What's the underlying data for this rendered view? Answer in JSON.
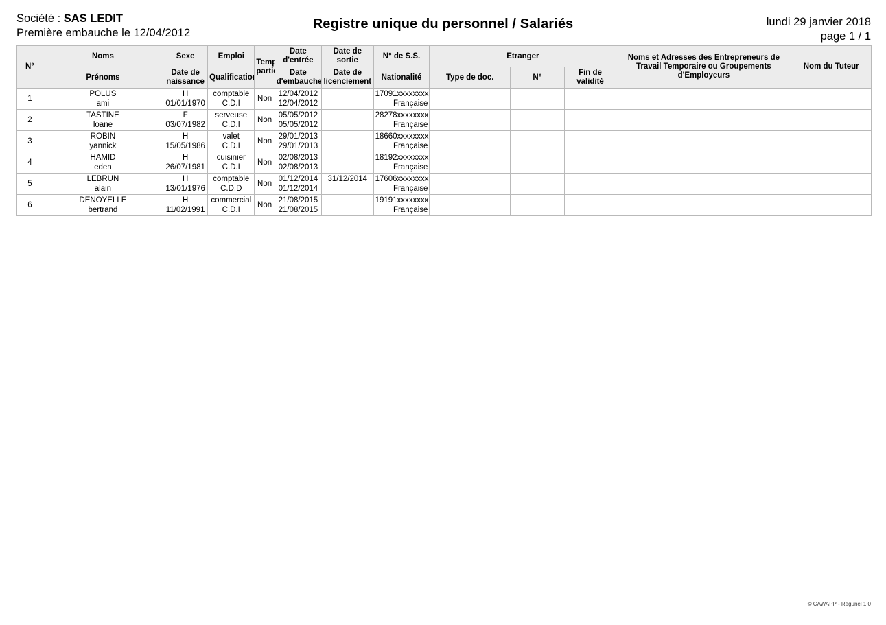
{
  "header": {
    "company_label": "Société : ",
    "company_name": "SAS LEDIT",
    "first_hire_line": "Première embauche le 12/04/2012",
    "title": "Registre unique du personnel / Salariés",
    "date": "lundi 29 janvier 2018",
    "page": "page 1 / 1"
  },
  "table": {
    "headers": {
      "num": "N°",
      "noms": "Noms",
      "prenoms": "Prénoms",
      "sexe": "Sexe",
      "date_naissance": "Date de naissance",
      "emploi": "Emploi",
      "qualification": "Qualification",
      "temps_partiel": "Temps partiel",
      "date_entree": "Date d'entrée",
      "date_embauche": "Date d'embauche",
      "date_sortie": "Date de sortie",
      "date_licenciement": "Date de licenciement",
      "num_ss": "N° de S.S.",
      "nationalite": "Nationalité",
      "etranger": "Etranger",
      "type_doc": "Type de doc.",
      "etranger_num": "N°",
      "fin_validite": "Fin de validité",
      "entrepreneurs": "Noms et Adresses des Entrepreneurs de Travail Temporaire ou Groupements d'Employeurs",
      "tuteur": "Nom du Tuteur"
    },
    "rows": [
      {
        "num": "1",
        "nom": "POLUS",
        "prenom": "ami",
        "sexe": "H",
        "date_naissance": "01/01/1970",
        "emploi": "comptable",
        "qualification": "C.D.I",
        "temps_partiel": "Non",
        "date_entree": "12/04/2012",
        "date_embauche": "12/04/2012",
        "date_sortie": "",
        "date_licenciement": "",
        "num_ss": "17091xxxxxxxx",
        "nationalite": "Française",
        "type_doc": "",
        "etranger_num": "",
        "fin_validite": "",
        "entrepreneurs": "",
        "tuteur": ""
      },
      {
        "num": "2",
        "nom": "TASTINE",
        "prenom": "loane",
        "sexe": "F",
        "date_naissance": "03/07/1982",
        "emploi": "serveuse",
        "qualification": "C.D.I",
        "temps_partiel": "Non",
        "date_entree": "05/05/2012",
        "date_embauche": "05/05/2012",
        "date_sortie": "",
        "date_licenciement": "",
        "num_ss": "28278xxxxxxxx",
        "nationalite": "Française",
        "type_doc": "",
        "etranger_num": "",
        "fin_validite": "",
        "entrepreneurs": "",
        "tuteur": ""
      },
      {
        "num": "3",
        "nom": "ROBIN",
        "prenom": "yannick",
        "sexe": "H",
        "date_naissance": "15/05/1986",
        "emploi": "valet",
        "qualification": "C.D.I",
        "temps_partiel": "Non",
        "date_entree": "29/01/2013",
        "date_embauche": "29/01/2013",
        "date_sortie": "",
        "date_licenciement": "",
        "num_ss": "18660xxxxxxxx",
        "nationalite": "Française",
        "type_doc": "",
        "etranger_num": "",
        "fin_validite": "",
        "entrepreneurs": "",
        "tuteur": ""
      },
      {
        "num": "4",
        "nom": "HAMID",
        "prenom": "eden",
        "sexe": "H",
        "date_naissance": "26/07/1981",
        "emploi": "cuisinier",
        "qualification": "C.D.I",
        "temps_partiel": "Non",
        "date_entree": "02/08/2013",
        "date_embauche": "02/08/2013",
        "date_sortie": "",
        "date_licenciement": "",
        "num_ss": "18192xxxxxxxx",
        "nationalite": "Française",
        "type_doc": "",
        "etranger_num": "",
        "fin_validite": "",
        "entrepreneurs": "",
        "tuteur": ""
      },
      {
        "num": "5",
        "nom": "LEBRUN",
        "prenom": "alain",
        "sexe": "H",
        "date_naissance": "13/01/1976",
        "emploi": "comptable",
        "qualification": "C.D.D",
        "temps_partiel": "Non",
        "date_entree": "01/12/2014",
        "date_embauche": "01/12/2014",
        "date_sortie": "31/12/2014",
        "date_licenciement": "",
        "num_ss": "17606xxxxxxxx",
        "nationalite": "Française",
        "type_doc": "",
        "etranger_num": "",
        "fin_validite": "",
        "entrepreneurs": "",
        "tuteur": ""
      },
      {
        "num": "6",
        "nom": "DENOYELLE",
        "prenom": "bertrand",
        "sexe": "H",
        "date_naissance": "11/02/1991",
        "emploi": "commercial",
        "qualification": "C.D.I",
        "temps_partiel": "Non",
        "date_entree": "21/08/2015",
        "date_embauche": "21/08/2015",
        "date_sortie": "",
        "date_licenciement": "",
        "num_ss": "19191xxxxxxxx",
        "nationalite": "Française",
        "type_doc": "",
        "etranger_num": "",
        "fin_validite": "",
        "entrepreneurs": "",
        "tuteur": ""
      }
    ]
  },
  "footer": {
    "copyright": "© CAWAPP - Regunel 1.0"
  },
  "colors": {
    "header_background": "#ececec",
    "border": "#b9b9b9",
    "text": "#000000"
  }
}
